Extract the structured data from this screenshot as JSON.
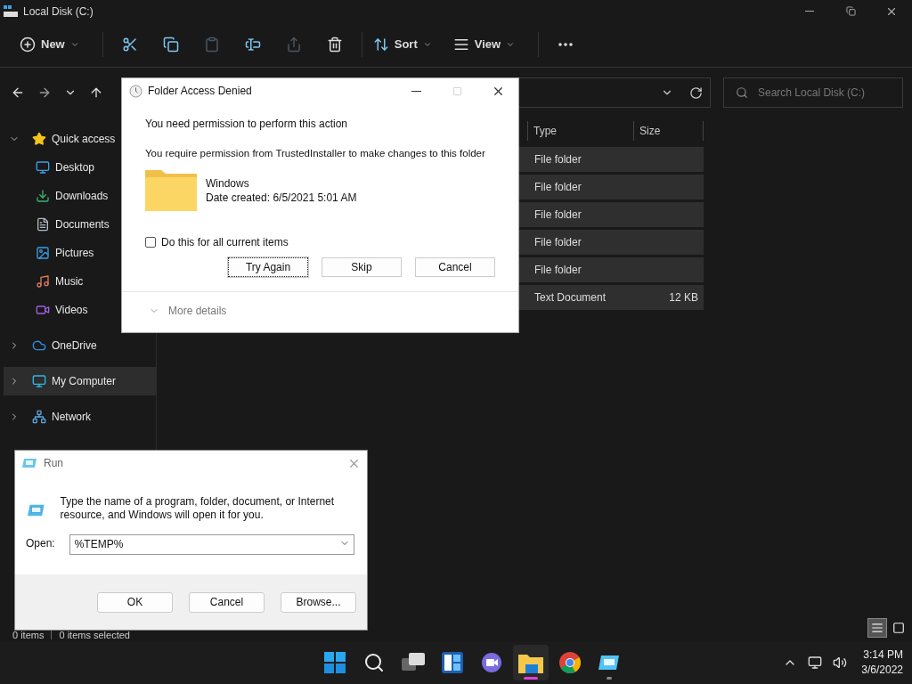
{
  "explorer": {
    "title": "Local Disk (C:)",
    "toolbar": [
      {
        "kind": "new",
        "label": "New",
        "disabled": false
      },
      {
        "kind": "cut",
        "disabled": false
      },
      {
        "kind": "copy",
        "disabled": false
      },
      {
        "kind": "paste",
        "disabled": true
      },
      {
        "kind": "rename",
        "disabled": false
      },
      {
        "kind": "share",
        "disabled": true
      },
      {
        "kind": "delete",
        "disabled": false
      },
      {
        "kind": "sort",
        "label": "Sort",
        "disabled": false
      },
      {
        "kind": "view",
        "label": "View",
        "disabled": false
      },
      {
        "kind": "more",
        "disabled": false
      }
    ],
    "search": {
      "placeholder": "Search Local Disk (C:)"
    },
    "sidebar": [
      {
        "kind": "star",
        "label": "Quick access",
        "expanded": true,
        "selected": false,
        "children": [
          {
            "kind": "desktop",
            "label": "Desktop",
            "selected": false
          },
          {
            "kind": "download",
            "label": "Downloads",
            "selected": false
          },
          {
            "kind": "document",
            "label": "Documents",
            "selected": false
          },
          {
            "kind": "picture",
            "label": "Pictures",
            "selected": false
          },
          {
            "kind": "music",
            "label": "Music",
            "selected": false
          },
          {
            "kind": "video",
            "label": "Videos",
            "selected": false
          }
        ]
      },
      {
        "kind": "cloud",
        "label": "OneDrive",
        "expanded": false,
        "selected": false
      },
      {
        "kind": "computer",
        "label": "My Computer",
        "expanded": false,
        "selected": true
      },
      {
        "kind": "network",
        "label": "Network",
        "expanded": false,
        "selected": false
      }
    ],
    "columns": [
      "Type",
      "Size"
    ],
    "rows": [
      {
        "type": "File folder"
      },
      {
        "type": "File folder"
      },
      {
        "type": "File folder"
      },
      {
        "type": "File folder"
      },
      {
        "type": "File folder"
      },
      {
        "type": "Text Document",
        "size": "12 KB"
      }
    ],
    "status": [
      "0 items",
      "0 items selected"
    ],
    "views": [
      {
        "kind": "details",
        "selected": true
      },
      {
        "kind": "tiles",
        "selected": false
      }
    ]
  },
  "access_dialog": {
    "title": "Folder Access Denied",
    "heading": "You need permission to perform this action",
    "message": "You require permission from TrustedInstaller to make changes to this folder",
    "item_name": "Windows",
    "item_date": "Date created: 6/5/2021 5:01 AM",
    "checkbox": {
      "label": "Do this for all current items",
      "checked": false
    },
    "buttons": [
      {
        "label": "Try Again",
        "focused": true
      },
      {
        "label": "Skip",
        "focused": false
      },
      {
        "label": "Cancel",
        "focused": false
      }
    ],
    "details": {
      "label": "More details",
      "expanded": false
    }
  },
  "run_dialog": {
    "title": "Run",
    "description": "Type the name of a program, folder, document, or Internet resource, and Windows will open it for you.",
    "open_label": "Open:",
    "value": "%TEMP%",
    "buttons": [
      "OK",
      "Cancel",
      "Browse..."
    ]
  },
  "taskbar": {
    "apps": [
      {
        "kind": "start",
        "active": false,
        "running": false
      },
      {
        "kind": "search",
        "active": false,
        "running": false
      },
      {
        "kind": "taskview",
        "active": false,
        "running": false
      },
      {
        "kind": "widgets",
        "active": false,
        "running": false
      },
      {
        "kind": "chat",
        "active": false,
        "running": false
      },
      {
        "kind": "explorer",
        "active": true,
        "running": true
      },
      {
        "kind": "chrome",
        "active": false,
        "running": false
      },
      {
        "kind": "run",
        "active": false,
        "running": true
      }
    ],
    "time": "3:14 PM",
    "date": "3/6/2022"
  }
}
